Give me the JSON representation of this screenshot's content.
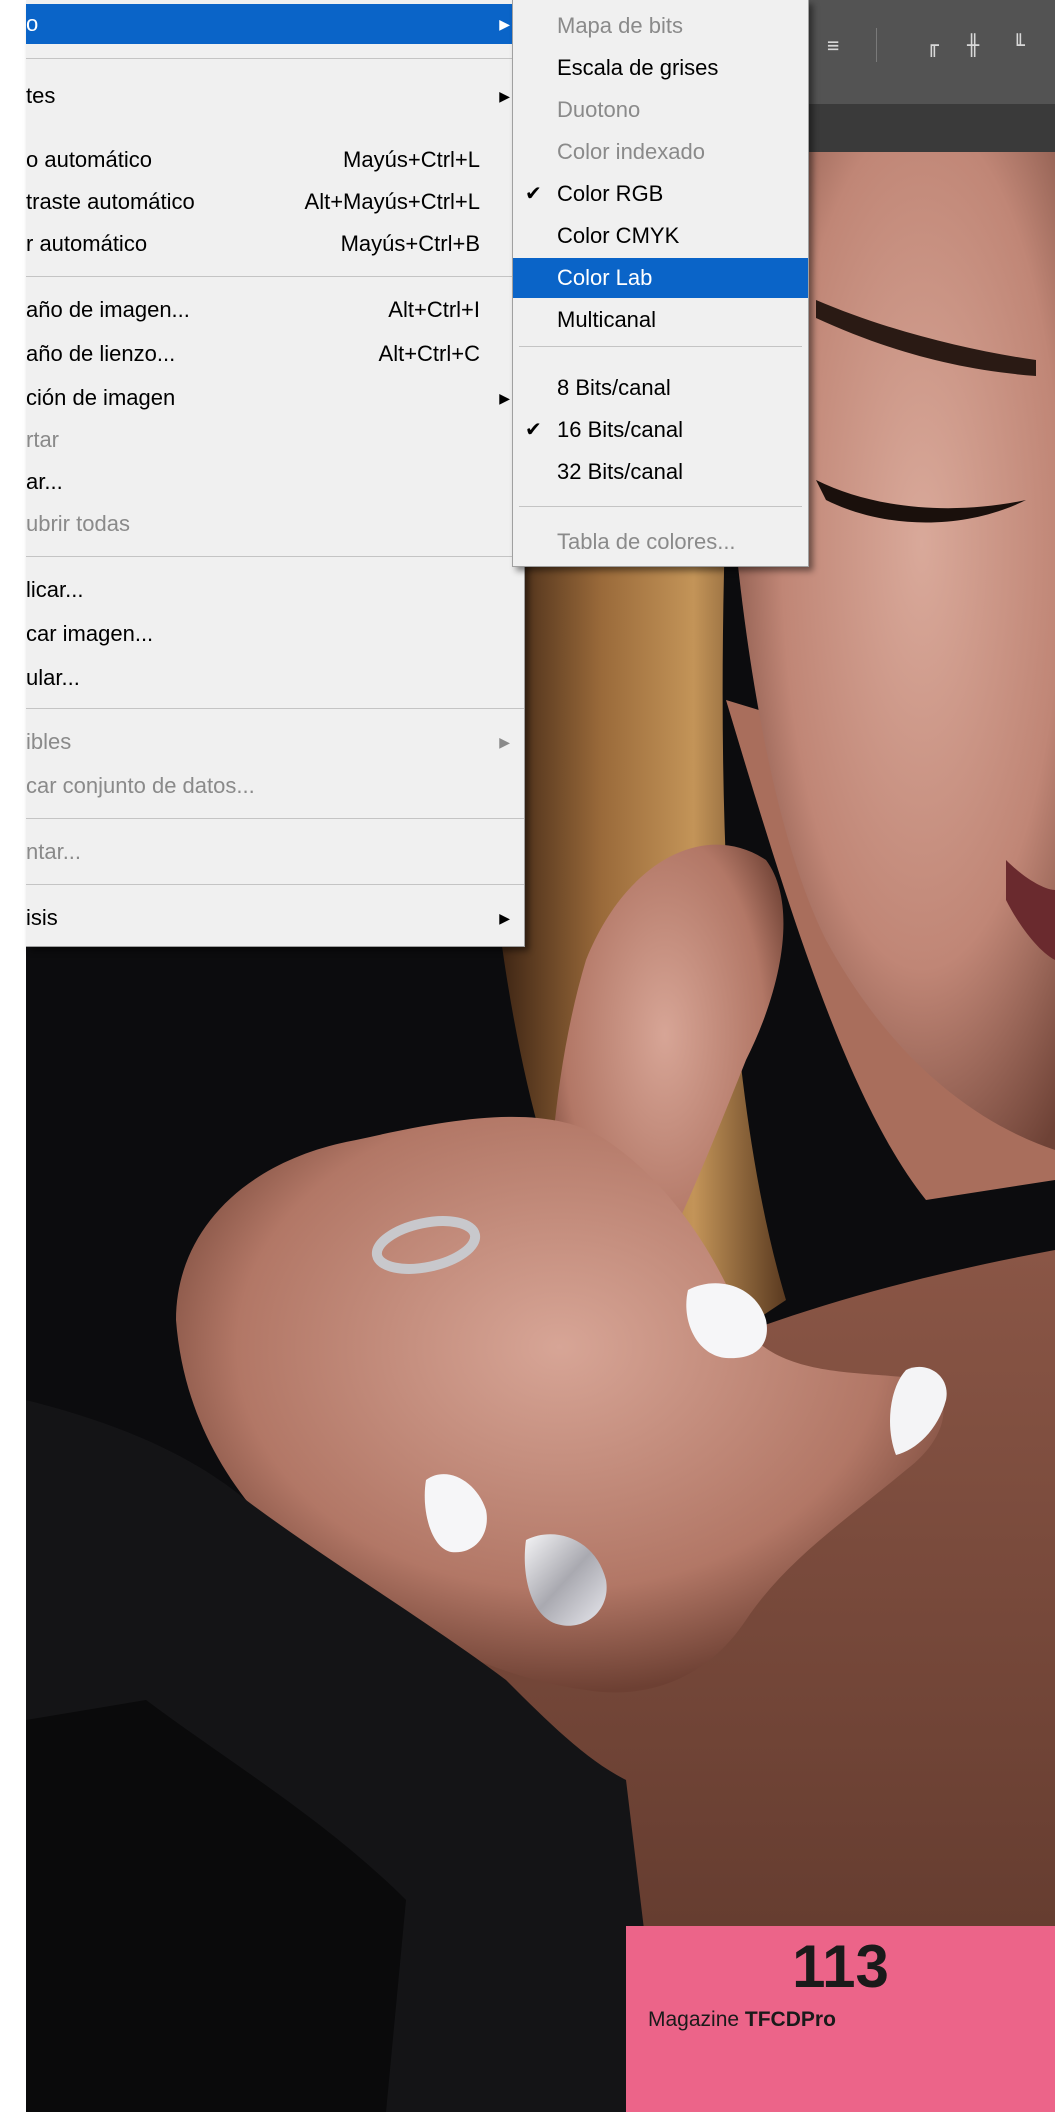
{
  "main_menu": {
    "items": [
      {
        "label": "o",
        "shortcut": "",
        "submenu": true,
        "disabled": false,
        "highlight": true
      },
      {
        "label": "tes",
        "shortcut": "",
        "submenu": true,
        "disabled": false
      },
      {
        "label": "o automático",
        "shortcut": "Mayús+Ctrl+L",
        "submenu": false,
        "disabled": false
      },
      {
        "label": "traste automático",
        "shortcut": "Alt+Mayús+Ctrl+L",
        "submenu": false,
        "disabled": false
      },
      {
        "label": "r automático",
        "shortcut": "Mayús+Ctrl+B",
        "submenu": false,
        "disabled": false
      },
      {
        "label": "año de imagen...",
        "shortcut": "Alt+Ctrl+I",
        "submenu": false,
        "disabled": false
      },
      {
        "label": "año de lienzo...",
        "shortcut": "Alt+Ctrl+C",
        "submenu": false,
        "disabled": false
      },
      {
        "label": "ción de imagen",
        "shortcut": "",
        "submenu": true,
        "disabled": false
      },
      {
        "label": "rtar",
        "shortcut": "",
        "submenu": false,
        "disabled": true
      },
      {
        "label": "ar...",
        "shortcut": "",
        "submenu": false,
        "disabled": false
      },
      {
        "label": "ubrir todas",
        "shortcut": "",
        "submenu": false,
        "disabled": true
      },
      {
        "label": "licar...",
        "shortcut": "",
        "submenu": false,
        "disabled": false
      },
      {
        "label": "car imagen...",
        "shortcut": "",
        "submenu": false,
        "disabled": false
      },
      {
        "label": "ular...",
        "shortcut": "",
        "submenu": false,
        "disabled": false
      },
      {
        "label": "ibles",
        "shortcut": "",
        "submenu": true,
        "disabled": true
      },
      {
        "label": "car conjunto de datos...",
        "shortcut": "",
        "submenu": false,
        "disabled": true
      },
      {
        "label": "ntar...",
        "shortcut": "",
        "submenu": false,
        "disabled": true
      },
      {
        "label": "isis",
        "shortcut": "",
        "submenu": true,
        "disabled": false
      }
    ]
  },
  "sub_menu": {
    "items": [
      {
        "label": "Mapa de bits",
        "checked": false,
        "disabled": true
      },
      {
        "label": "Escala de grises",
        "checked": false,
        "disabled": false
      },
      {
        "label": "Duotono",
        "checked": false,
        "disabled": true
      },
      {
        "label": "Color indexado",
        "checked": false,
        "disabled": true
      },
      {
        "label": "Color RGB",
        "checked": true,
        "disabled": false
      },
      {
        "label": "Color CMYK",
        "checked": false,
        "disabled": false
      },
      {
        "label": "Color Lab",
        "checked": false,
        "disabled": false,
        "highlight": true
      },
      {
        "label": "Multicanal",
        "checked": false,
        "disabled": false
      },
      {
        "label": "8 Bits/canal",
        "checked": false,
        "disabled": false
      },
      {
        "label": "16 Bits/canal",
        "checked": true,
        "disabled": false
      },
      {
        "label": "32 Bits/canal",
        "checked": false,
        "disabled": false
      },
      {
        "label": "Tabla de colores...",
        "checked": false,
        "disabled": true
      }
    ]
  },
  "glyphs": {
    "check": "✔",
    "arrow": "▶"
  },
  "toolbar": {
    "icons": [
      "align-center-icon",
      "align-top-icon",
      "align-middle-icon",
      "align-bottom-icon"
    ]
  },
  "badge": {
    "number": "113",
    "magazine": "Magazine",
    "brand": "TFCDPro",
    "color": "#ec6489"
  },
  "colors": {
    "menu_bg": "#f0f0f0",
    "highlight": "#0a64c8"
  }
}
